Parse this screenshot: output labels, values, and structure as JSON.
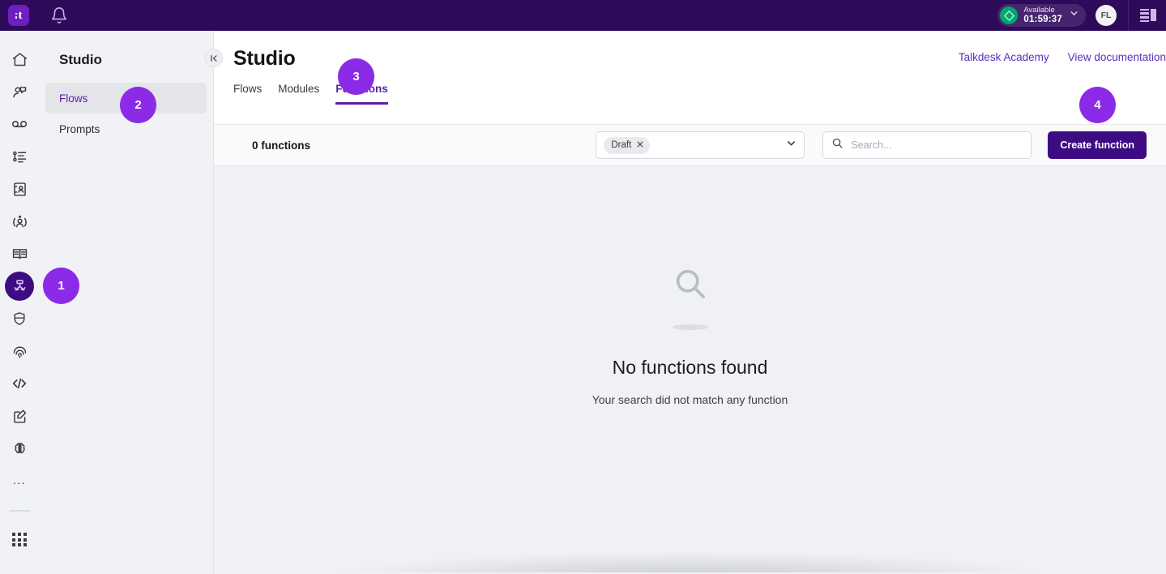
{
  "topbar": {
    "brand_letter": "t",
    "notifications_icon": "bell-icon",
    "status": {
      "label": "Available",
      "time": "01:59:37"
    },
    "avatar_initials": "FL"
  },
  "rail": {
    "items": [
      {
        "name": "home-icon"
      },
      {
        "name": "conversations-icon"
      },
      {
        "name": "voicemail-icon"
      },
      {
        "name": "activity-list-icon"
      },
      {
        "name": "contacts-book-icon"
      },
      {
        "name": "agent-icon"
      },
      {
        "name": "knowledge-book-icon"
      },
      {
        "name": "flows-icon"
      },
      {
        "name": "shield-icon"
      },
      {
        "name": "fingerprint-icon"
      },
      {
        "name": "code-icon"
      },
      {
        "name": "compose-icon"
      },
      {
        "name": "brain-icon"
      }
    ],
    "more_label": "...",
    "apps_icon": "apps-grid-icon"
  },
  "subnav": {
    "title": "Studio",
    "items": [
      {
        "label": "Flows",
        "selected": true
      },
      {
        "label": "Prompts",
        "selected": false
      }
    ],
    "collapse_icon": "collapse-panel-icon"
  },
  "main": {
    "title": "Studio",
    "help_links": [
      {
        "label": "Talkdesk Academy"
      },
      {
        "label": "View documentation"
      }
    ],
    "tabs": [
      {
        "label": "Flows",
        "active": false
      },
      {
        "label": "Modules",
        "active": false
      },
      {
        "label": "Functions",
        "active": true
      }
    ],
    "toolbar": {
      "count_label": "0 functions",
      "filter_chip": "Draft",
      "filter_chip_remove_icon": "close-icon",
      "filter_caret_icon": "chevron-down-icon",
      "search_placeholder": "Search...",
      "search_value": "",
      "search_icon": "search-icon",
      "create_button": "Create function"
    },
    "empty_state": {
      "icon": "search-icon",
      "title": "No functions found",
      "subtitle": "Your search did not match any function"
    }
  },
  "walkthrough_badges": [
    {
      "number": "1"
    },
    {
      "number": "2"
    },
    {
      "number": "3"
    },
    {
      "number": "4"
    }
  ],
  "colors": {
    "brand_purple": "#3D0B82",
    "topbar_purple": "#2D0B5A",
    "accent_purple": "#5B1FA8",
    "badge_purple": "#8B2BE8",
    "available_green": "#00A86B",
    "content_bg": "#F0F1F4"
  }
}
